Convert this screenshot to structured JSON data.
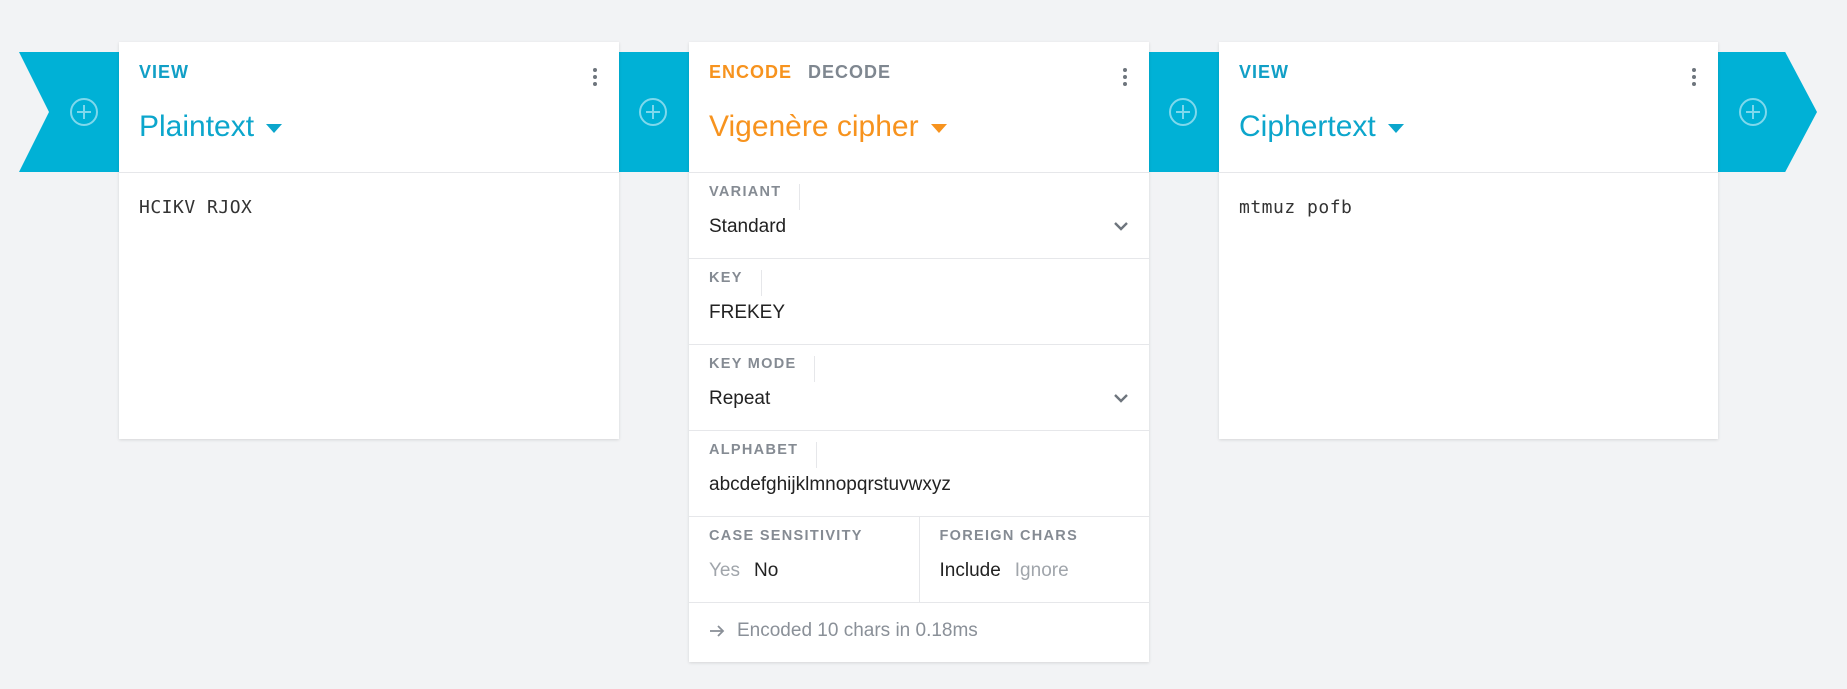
{
  "colors": {
    "accent_cyan": "#00b1d6",
    "accent_orange": "#f7931e",
    "background": "#f2f3f5"
  },
  "left_card": {
    "tab_label": "VIEW",
    "title": "Plaintext",
    "content": "HCIKV RJOX"
  },
  "middle_card": {
    "tabs": [
      {
        "label": "ENCODE",
        "active": true
      },
      {
        "label": "DECODE",
        "active": false
      }
    ],
    "title": "Vigenère cipher",
    "settings": {
      "variant": {
        "label": "VARIANT",
        "value": "Standard"
      },
      "key": {
        "label": "KEY",
        "value": "FREKEY"
      },
      "key_mode": {
        "label": "KEY MODE",
        "value": "Repeat"
      },
      "alphabet": {
        "label": "ALPHABET",
        "value": "abcdefghijklmnopqrstuvwxyz"
      },
      "case_sensitivity": {
        "label": "CASE SENSITIVITY",
        "options": [
          "Yes",
          "No"
        ],
        "selected": "No"
      },
      "foreign_chars": {
        "label": "FOREIGN CHARS",
        "options": [
          "Include",
          "Ignore"
        ],
        "selected": "Include"
      }
    },
    "status": "Encoded 10 chars in 0.18ms"
  },
  "right_card": {
    "tab_label": "VIEW",
    "title": "Ciphertext",
    "content": "mtmuz pofb"
  },
  "icons": {
    "add": "plus-circle-icon",
    "more": "more-vertical-icon",
    "caret": "caret-down-icon",
    "chevron": "chevron-down-icon",
    "arrow": "arrow-right-icon"
  }
}
